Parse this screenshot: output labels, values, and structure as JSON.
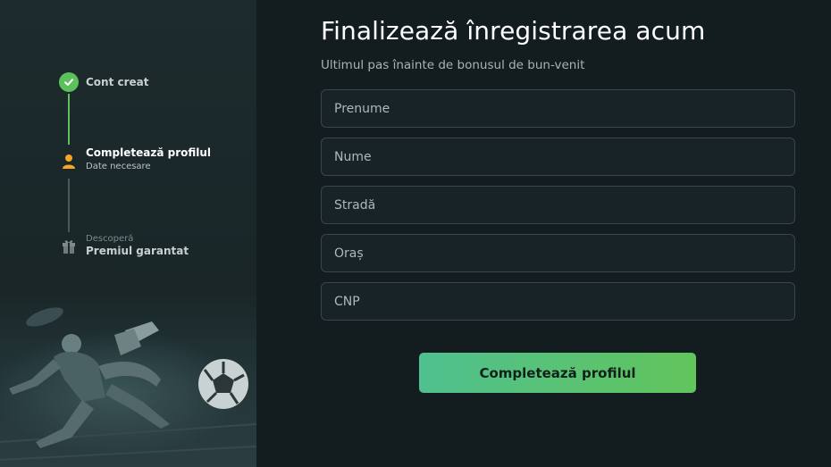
{
  "steps": [
    {
      "title": "Cont creat",
      "status": "completed",
      "icon": "check-icon"
    },
    {
      "title": "Completează profilul",
      "subtitle": "Date necesare",
      "status": "current",
      "icon": "user-icon"
    },
    {
      "pre": "Descoperă",
      "title": "Premiul garantat",
      "status": "upcoming",
      "icon": "gift-icon"
    }
  ],
  "form": {
    "title": "Finalizează înregistrarea acum",
    "subtitle": "Ultimul pas înainte de bonusul de bun-venit",
    "fields": [
      {
        "placeholder": "Prenume",
        "value": ""
      },
      {
        "placeholder": "Nume",
        "value": ""
      },
      {
        "placeholder": "Stradă",
        "value": ""
      },
      {
        "placeholder": "Oraș",
        "value": ""
      },
      {
        "placeholder": "CNP",
        "value": ""
      }
    ],
    "submit_label": "Completează profilul"
  },
  "colors": {
    "accent_green": "#5cc15b",
    "current_step_orange": "#f5a623",
    "button_gradient_start": "#4fc08f",
    "button_gradient_end": "#62c45b",
    "background": "#131d20"
  }
}
